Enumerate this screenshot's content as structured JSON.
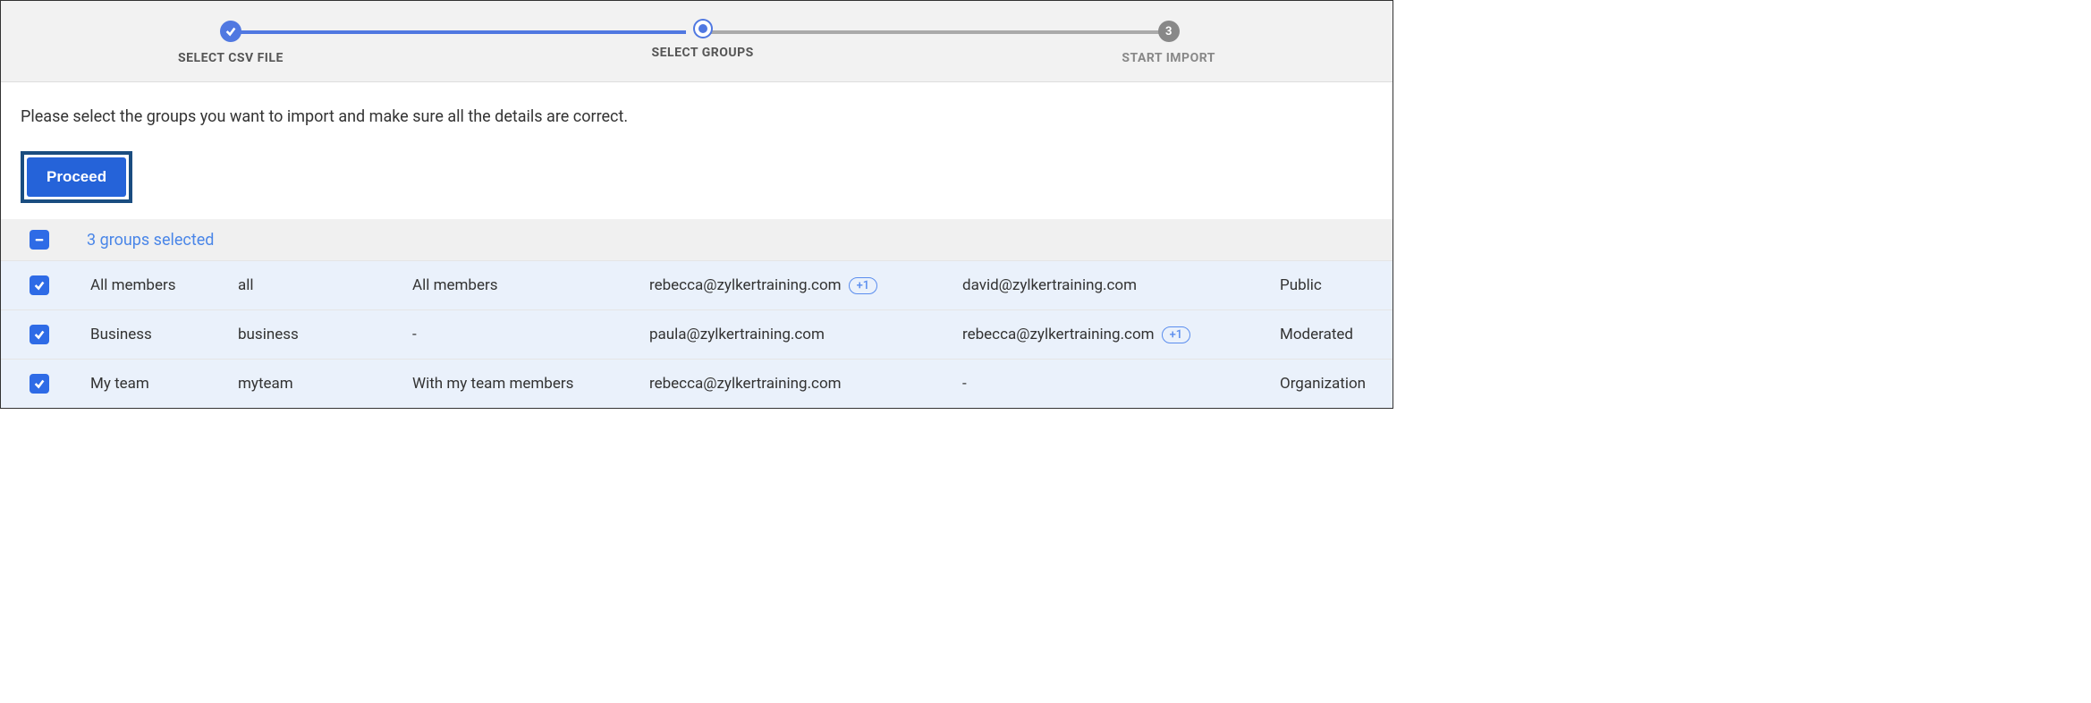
{
  "stepper": {
    "steps": [
      {
        "label": "SELECT CSV FILE",
        "state": "done"
      },
      {
        "label": "SELECT GROUPS",
        "state": "current"
      },
      {
        "label": "START IMPORT",
        "state": "pending",
        "num": "3"
      }
    ]
  },
  "instruction": "Please select the groups you want to import and make sure all the details are correct.",
  "proceed_label": "Proceed",
  "selected_text": "3 groups selected",
  "rows": [
    {
      "name": "All members",
      "alias": "all",
      "desc": "All members",
      "email1": "rebecca@zylkertraining.com",
      "extra1": "+1",
      "email2": "david@zylkertraining.com",
      "extra2": "",
      "access": "Public"
    },
    {
      "name": "Business",
      "alias": "business",
      "desc": "-",
      "email1": "paula@zylkertraining.com",
      "extra1": "",
      "email2": "rebecca@zylkertraining.com",
      "extra2": "+1",
      "access": "Moderated"
    },
    {
      "name": "My team",
      "alias": "myteam",
      "desc": "With my team members",
      "email1": "rebecca@zylkertraining.com",
      "extra1": "",
      "email2": "-",
      "extra2": "",
      "access": "Organization"
    }
  ]
}
